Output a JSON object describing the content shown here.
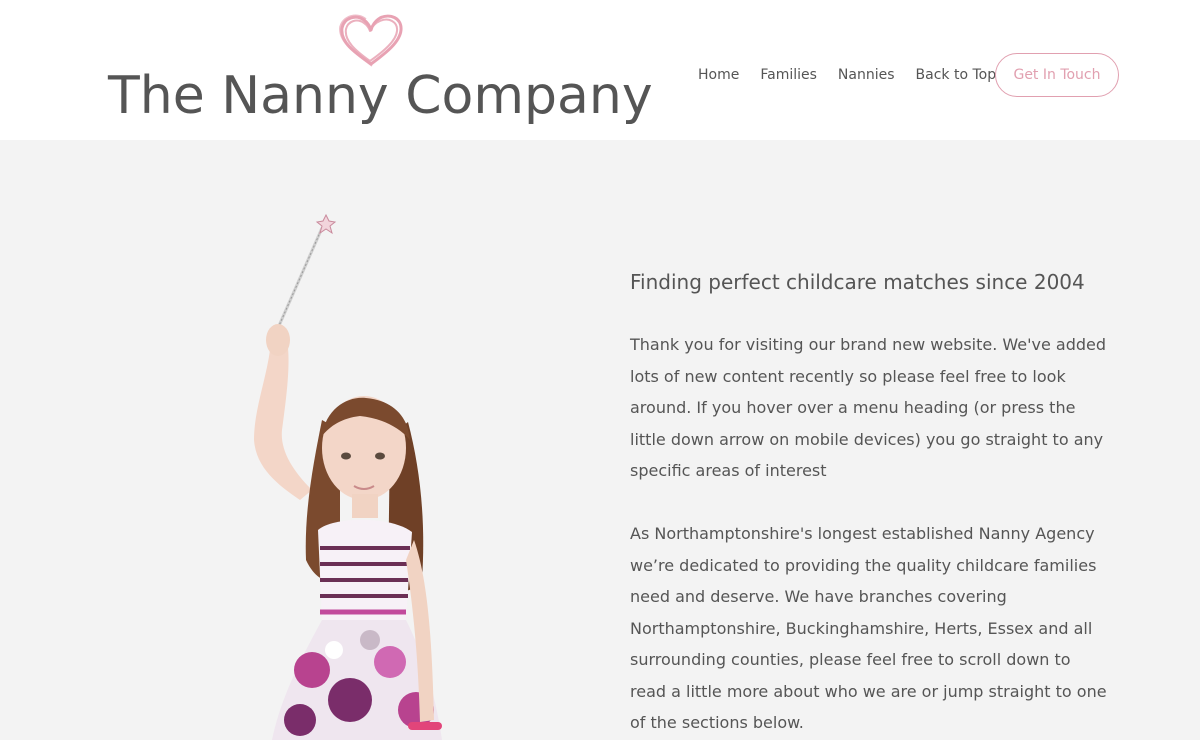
{
  "brand": {
    "name": "The Nanny Company",
    "heart_color": "#e8a2b3",
    "text_color": "#555555"
  },
  "nav": {
    "items": [
      {
        "label": "Home"
      },
      {
        "label": "Families"
      },
      {
        "label": "Nannies"
      },
      {
        "label": "Back to Top"
      }
    ],
    "cta_label": "Get In Touch",
    "cta_color": "#e1a0b0"
  },
  "hero": {
    "tagline": "Finding perfect childcare matches since 2004",
    "paragraph_1": "Thank you for visiting our brand new website. We've added lots of new content recently so please feel free to look around. If you hover over a menu heading (or press the little down arrow on mobile devices) you go straight to any specific areas of interest",
    "paragraph_2": "As Northamptonshire's longest established Nanny Agency we’re dedicated to providing the quality childcare families need and deserve. We have branches covering Northamptonshire, Buckinghamshire, Herts, Essex and all surrounding counties, please feel free to scroll down to read a little more about who we are or jump straight to one of the sections below.",
    "background": "#f3f3f3"
  }
}
